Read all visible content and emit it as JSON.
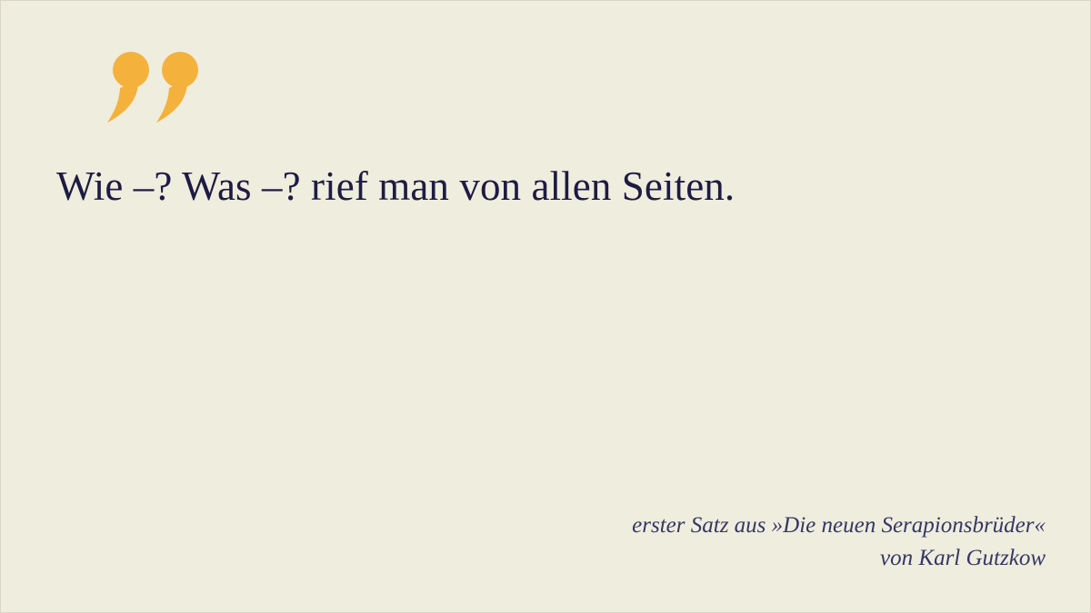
{
  "quote": {
    "mark_icon": "closing-quotation-mark-icon",
    "mark_color": "#f4b23d",
    "text": "Wie –? Was –? rief man von allen Seiten."
  },
  "attribution": {
    "line1": "erster Satz aus »Die neuen Serapionsbrüder«",
    "line2": "von Karl Gutzkow"
  },
  "colors": {
    "background": "#efeddd",
    "text": "#1e1b43",
    "attribution": "#353766"
  }
}
